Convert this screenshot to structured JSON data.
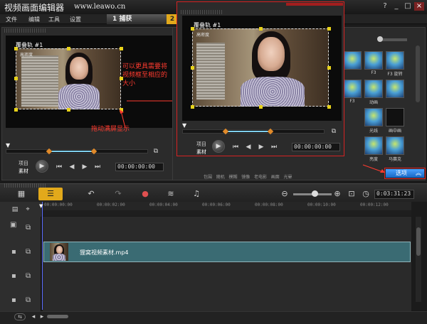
{
  "app": {
    "title": "视频画面编辑器",
    "site": "www.leawo.cn"
  },
  "menu": [
    "文件",
    "编辑",
    "工具",
    "设置"
  ],
  "steps": [
    {
      "num": "1",
      "label": "捕获"
    },
    {
      "num": "2",
      "label": ""
    }
  ],
  "preview_left": {
    "track_title": "覆叠轨 #1",
    "track_sub": "高密度",
    "mode_top": "项目",
    "mode_bottom": "素材",
    "timecode": "00:00:00:00",
    "annotation_resize": "可以更具需要将视频框至相应的大小",
    "annotation_drag": "拖动满屏显示"
  },
  "preview_popup": {
    "track_title": "覆叠轨 #1",
    "track_sub": "高密度",
    "mode_top": "项目",
    "mode_bottom": "素材",
    "timecode": "00:00:00:00"
  },
  "library": {
    "effects": [
      {
        "label": ""
      },
      {
        "label": "F3"
      },
      {
        "label": "F3 旋转"
      },
      {
        "label": "F3"
      },
      {
        "label": "动画"
      },
      {
        "label": ""
      },
      {
        "label": "光线"
      },
      {
        "label": "画中画"
      },
      {
        "label": "亮度"
      },
      {
        "label": "马赛克"
      }
    ],
    "options_label": "选项",
    "bottom_labels": [
      "包围",
      "随机",
      "模糊",
      "镜像",
      "老电影",
      "画面",
      "光晕"
    ]
  },
  "timeline": {
    "timecode": "0:03:31:23",
    "ruler": [
      "00:00:00:00",
      "00:00:02:00",
      "00:00:04:00",
      "00:00:06:00",
      "00:00:08:00",
      "00:00:10:00",
      "00:00:12:00"
    ],
    "clip_label": "狸窝视频素材.mp4"
  }
}
